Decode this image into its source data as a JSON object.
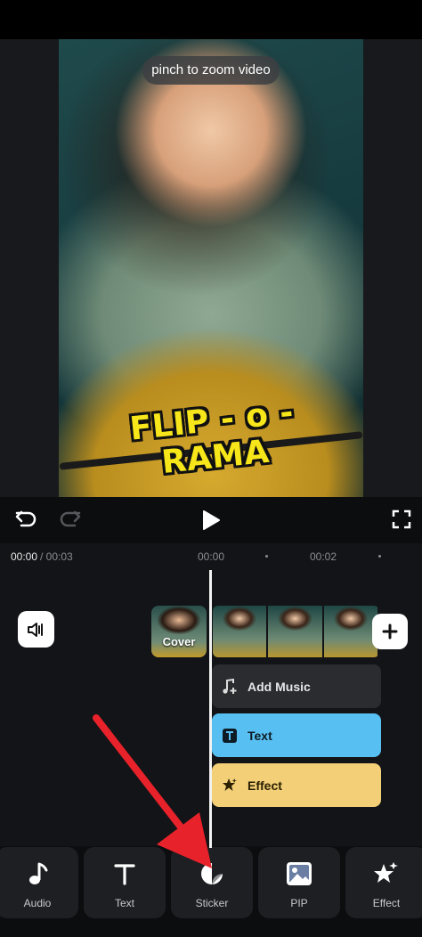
{
  "preview": {
    "tooltip": "pinch to zoom video",
    "overlay_text": "FLIP - o - RAMA"
  },
  "playback": {
    "undo_icon": "undo-icon",
    "redo_icon": "redo-icon",
    "play_icon": "play-icon",
    "fullscreen_icon": "fullscreen-icon"
  },
  "timeline": {
    "current_time": "00:00",
    "total_time": "/ 00:03",
    "ticks": [
      "00:00",
      "00:02"
    ],
    "cover_label": "Cover",
    "tracks": {
      "music": "Add Music",
      "text": "Text",
      "effect": "Effect"
    },
    "track_colors": {
      "text": "#58bff2",
      "effect": "#f3cf77",
      "music": "#2a2c30"
    }
  },
  "toolbar": {
    "items": [
      {
        "label": "Audio",
        "icon": "music-note-icon"
      },
      {
        "label": "Text",
        "icon": "text-icon"
      },
      {
        "label": "Sticker",
        "icon": "sticker-icon"
      },
      {
        "label": "PIP",
        "icon": "image-icon"
      },
      {
        "label": "Effect",
        "icon": "star-effect-icon"
      }
    ]
  },
  "annotation": {
    "arrow_color": "#e8222a"
  }
}
